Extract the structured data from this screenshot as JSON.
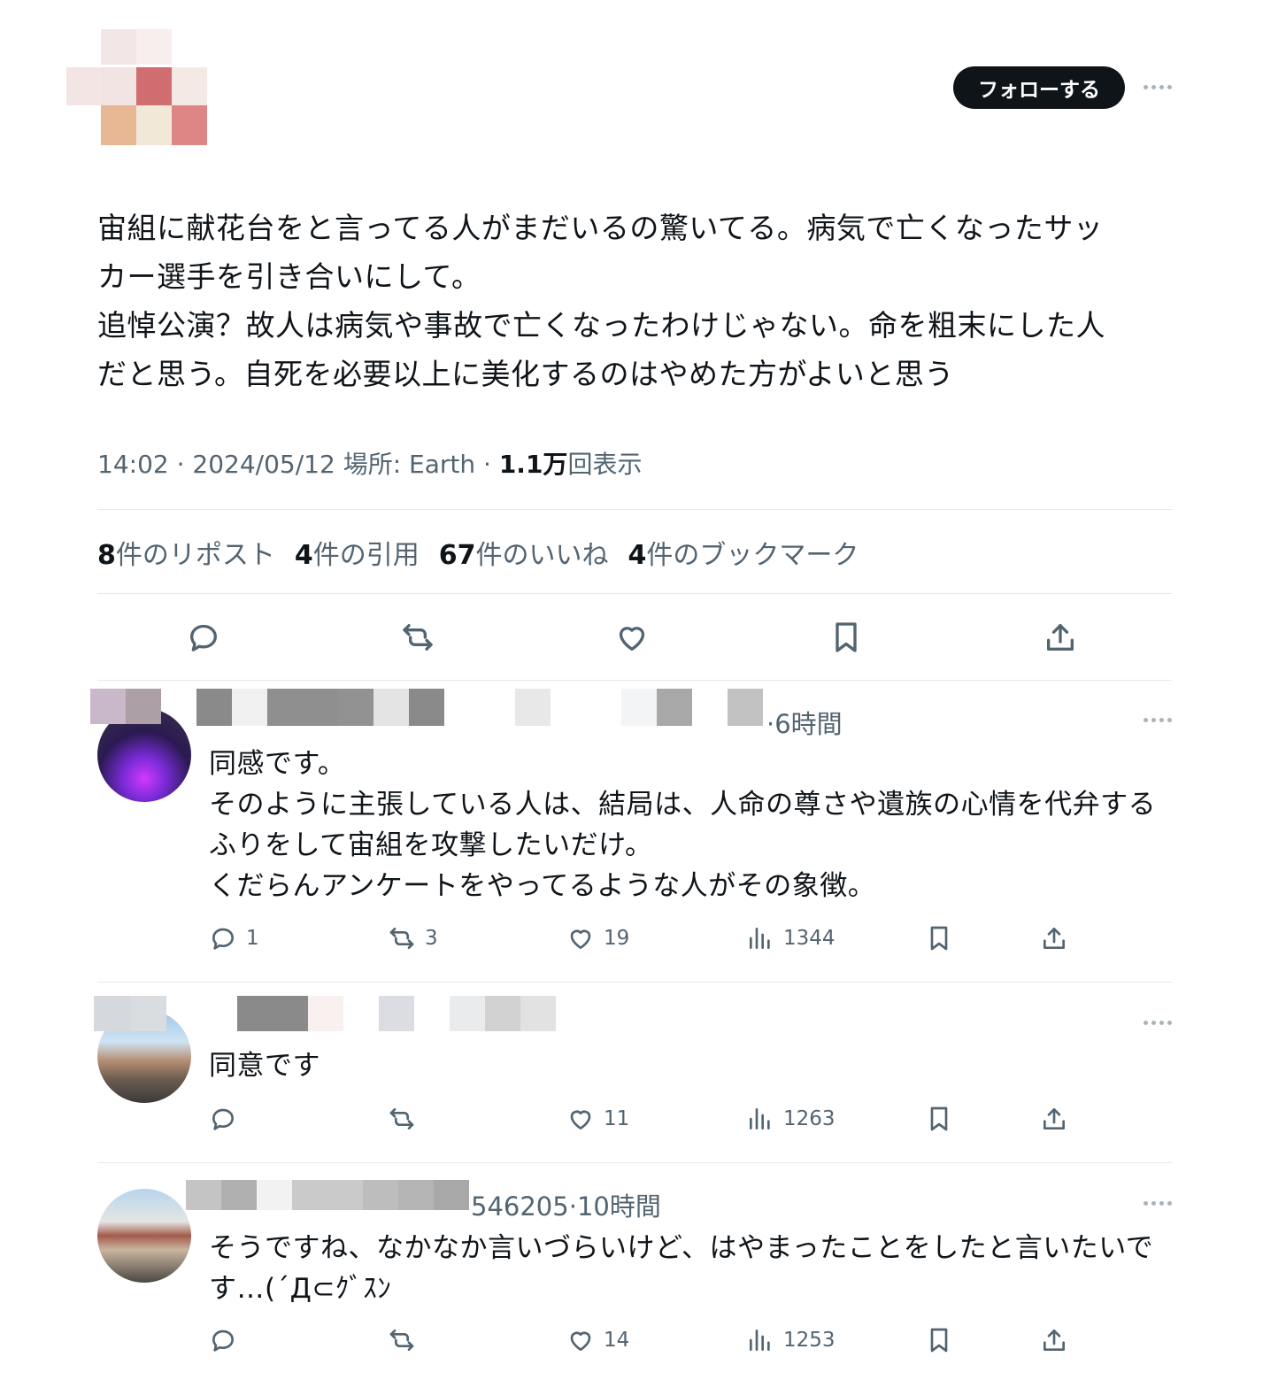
{
  "author": {
    "follow_label": "フォローする"
  },
  "tweet": {
    "lines": [
      "宙組に献花台をと言ってる人がまだいるの驚いてる。病気で亡くなったサッ",
      "カー選手を引き合いにして。",
      "追悼公演？故人は病気や事故で亡くなったわけじゃない。命を粗末にした人",
      "だと思う。自死を必要以上に美化するのはやめた方がよいと思う"
    ],
    "time": "14:02",
    "date": "2024/05/12",
    "location": "場所: Earth",
    "views_num": "1.1万",
    "views_label": "回表示"
  },
  "stats": {
    "reposts_num": "8",
    "reposts_label": "件のリポスト",
    "quotes_num": "4",
    "quotes_label": "件の引用",
    "likes_num": "67",
    "likes_label": "件のいいね",
    "bookmarks_num": "4",
    "bookmarks_label": "件のブックマーク"
  },
  "replies": [
    {
      "name_partial": "Ultras Jankee Lover& Sienne",
      "handle_partial": "@yuzulove0112",
      "time": "6時間",
      "lines": [
        "同感です。",
        "そのように主張している人は、結局は、人命の尊さや遺族の心情を代弁する",
        "ふりをして宙組を攻撃したいだけ。",
        "くだらんアンケートをやってるような人がその象徴。"
      ],
      "replies": "1",
      "reposts": "3",
      "likes": "19",
      "views": "1344"
    },
    {
      "lines": [
        "同意です"
      ],
      "replies": "",
      "reposts": "",
      "likes": "11",
      "views": "1263"
    },
    {
      "handle_partial": "546205",
      "time": "10時間",
      "lines": [
        "そうですね、なかなか言いづらいけど、はやまったことをしたと言いたいで",
        "す…(´Д⊂ｸﾞｽﾝ"
      ],
      "replies": "",
      "reposts": "",
      "likes": "14",
      "views": "1253"
    }
  ],
  "colors": {
    "text": "#0f1419",
    "secondary": "#536471",
    "divider": "#e6e9eb",
    "follow_bg": "#0f1419"
  },
  "icons": [
    "reply-icon",
    "repost-icon",
    "like-icon",
    "views-icon",
    "bookmark-icon",
    "share-icon",
    "more-icon"
  ]
}
